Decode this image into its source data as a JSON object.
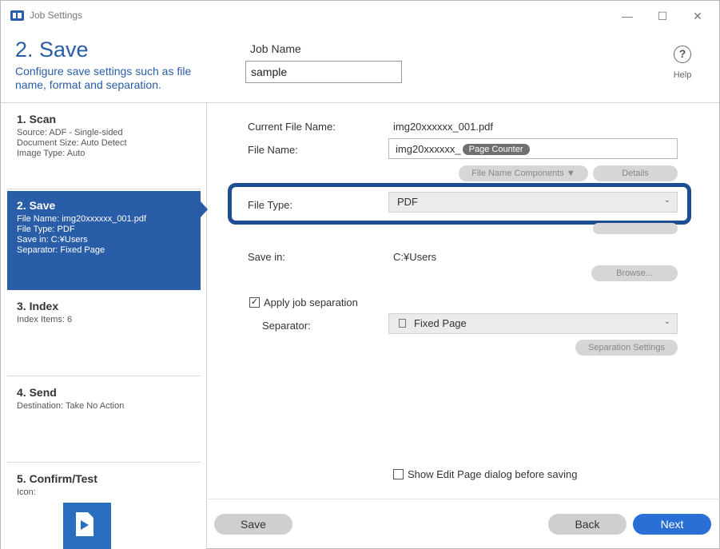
{
  "window": {
    "title": "Job Settings",
    "minimize": "—",
    "maximize": "☐",
    "close": "✕"
  },
  "header": {
    "step_title": "2. Save",
    "description": "Configure save settings such as file name, format and separation.",
    "job_name_label": "Job Name",
    "job_name_value": "sample",
    "help_label": "Help",
    "help_icon": "?"
  },
  "sidebar": {
    "steps": [
      {
        "name": "1. Scan",
        "lines": [
          "Source: ADF - Single-sided",
          "Document Size: Auto Detect",
          "Image Type: Auto"
        ]
      },
      {
        "name": "2. Save",
        "lines": [
          "File Name: img20xxxxxx_001.pdf",
          "File Type: PDF",
          "Save in: C:¥Users",
          "Separator: Fixed Page"
        ]
      },
      {
        "name": "3. Index",
        "lines": [
          "Index Items: 6"
        ]
      },
      {
        "name": "4. Send",
        "lines": [
          "Destination: Take No Action"
        ]
      },
      {
        "name": "5. Confirm/Test",
        "lines": [
          "Icon:"
        ]
      }
    ]
  },
  "main": {
    "current_file_name_label": "Current File Name:",
    "current_file_name_value": "img20xxxxxx_001.pdf",
    "file_name_label": "File Name:",
    "file_name_prefix": "img20xxxxxx_",
    "file_name_token": "Page Counter",
    "file_name_components_button": "File Name Components ▼",
    "details_button": "Details",
    "file_type_label": "File Type:",
    "file_type_value": "PDF",
    "save_in_label": "Save in:",
    "save_in_value": "C:¥Users",
    "browse_button": "Browse...",
    "apply_separation_label": "Apply job separation",
    "apply_separation_checked": "✓",
    "separator_label": "Separator:",
    "separator_value": "Fixed Page",
    "separation_settings_button": "Separation Settings",
    "show_edit_page_label": "Show Edit Page dialog before saving"
  },
  "footer": {
    "save_button": "Save",
    "back_button": "Back",
    "next_button": "Next"
  },
  "colors": {
    "accent": "#2a5da8",
    "highlight_border": "#1d4e93",
    "next_button": "#2a6fd3"
  }
}
